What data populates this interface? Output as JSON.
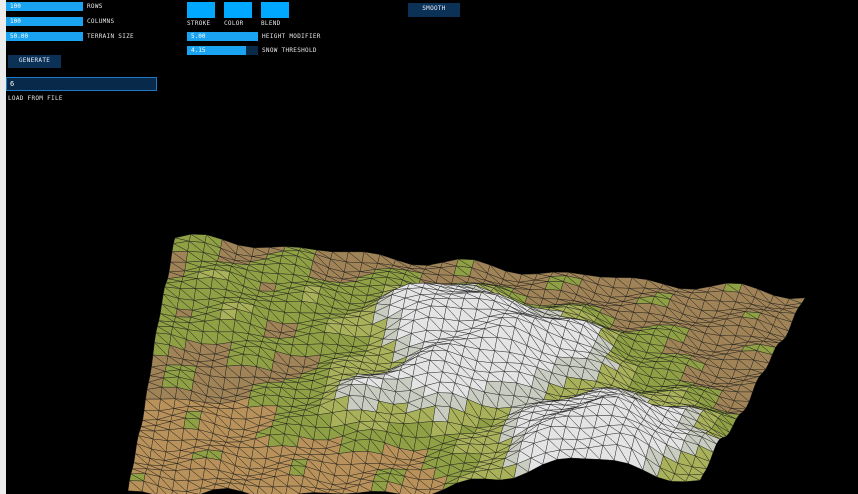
{
  "controls": {
    "rows": {
      "value": "100",
      "label": "ROWS",
      "fill": 1.0
    },
    "columns": {
      "value": "100",
      "label": "COLUMNS",
      "fill": 1.0
    },
    "terrain_size": {
      "value": "50.00",
      "label": "TERRAIN SIZE",
      "fill": 1.0
    },
    "height_modifier": {
      "value": "5.00",
      "label": "HEIGHT MODIFIER",
      "fill": 1.0
    },
    "snow_threshold": {
      "value": "4.15",
      "label": "SNOW THRESHOLD",
      "fill": 0.83
    },
    "toggles": {
      "stroke": "STROKE",
      "color": "COLOR",
      "blend": "BLEND"
    },
    "generate_label": "GENERATE",
    "smooth_label": "SMOOTH",
    "file_value": "6",
    "load_label": "LOAD FROM FILE"
  },
  "colors": {
    "slider_fill": "#1aa3f0",
    "slider_bg": "#0a2a4a",
    "toggle_active": "#00a8ff",
    "button_bg": "#0c3157",
    "background": "#000000"
  }
}
